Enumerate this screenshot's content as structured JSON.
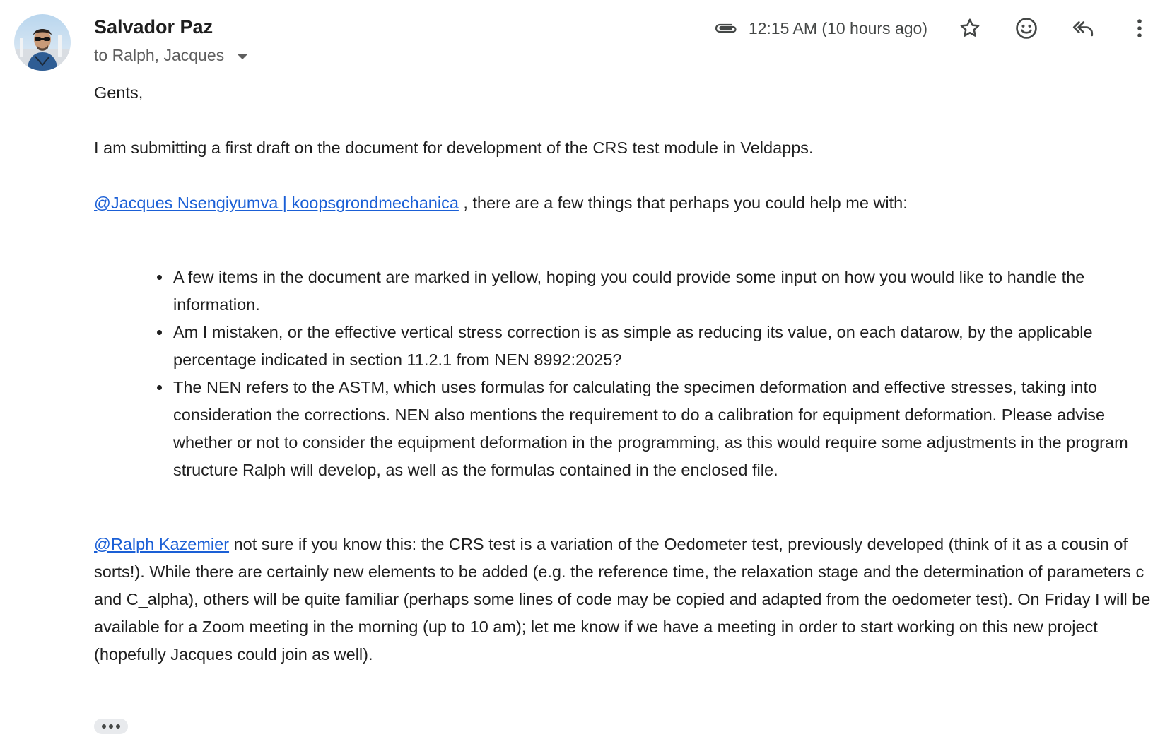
{
  "sender": {
    "name": "Salvador Paz",
    "recipients": "to Ralph, Jacques"
  },
  "header": {
    "timestamp": "12:15 AM (10 hours ago)",
    "icons": [
      "attachment-icon",
      "star-icon",
      "emoji-icon",
      "reply-all-icon",
      "more-vert-icon"
    ]
  },
  "message": {
    "greeting": "Gents,",
    "intro": "I am submitting a first draft on the document for development of the CRS test module in Veldapps.",
    "mention1": "@Jacques Nsengiyumva | koopsgrondmechanica",
    "mention1_after": " , there are a few things that perhaps you could help me with:",
    "bullets": [
      "A few items in the document are marked in yellow, hoping you could provide some input on how you would like to handle the information.",
      "Am I mistaken, or the effective vertical stress correction is as simple as reducing its value, on each datarow, by the applicable percentage indicated in section 11.2.1 from NEN 8992:2025?",
      "The NEN refers to the ASTM, which uses formulas for calculating the specimen deformation and effective stresses, taking into consideration the corrections. NEN also mentions the requirement to do a calibration for equipment deformation. Please advise whether or not to consider the equipment deformation in the programming, as this would require some adjustments in the program structure Ralph will develop, as well as the formulas contained in the enclosed file."
    ],
    "mention2": "@Ralph Kazemier",
    "mention2_after": " not sure if you know this: the CRS test is a variation of the Oedometer test, previously developed (think of it as a cousin of sorts!). While there are certainly new elements to be added (e.g. the reference time, the relaxation stage and the determination of parameters c and C_alpha), others will be quite familiar (perhaps some lines of code may be copied and adapted from the oedometer test). On Friday I will be available for a Zoom meeting in the morning (up to 10 am); let me know if we have a meeting in order to start working on this new project (hopefully Jacques could join as well)."
  },
  "colors": {
    "link": "#1a5fd6",
    "text": "#1f1f1f",
    "muted": "#5e5e5e"
  }
}
